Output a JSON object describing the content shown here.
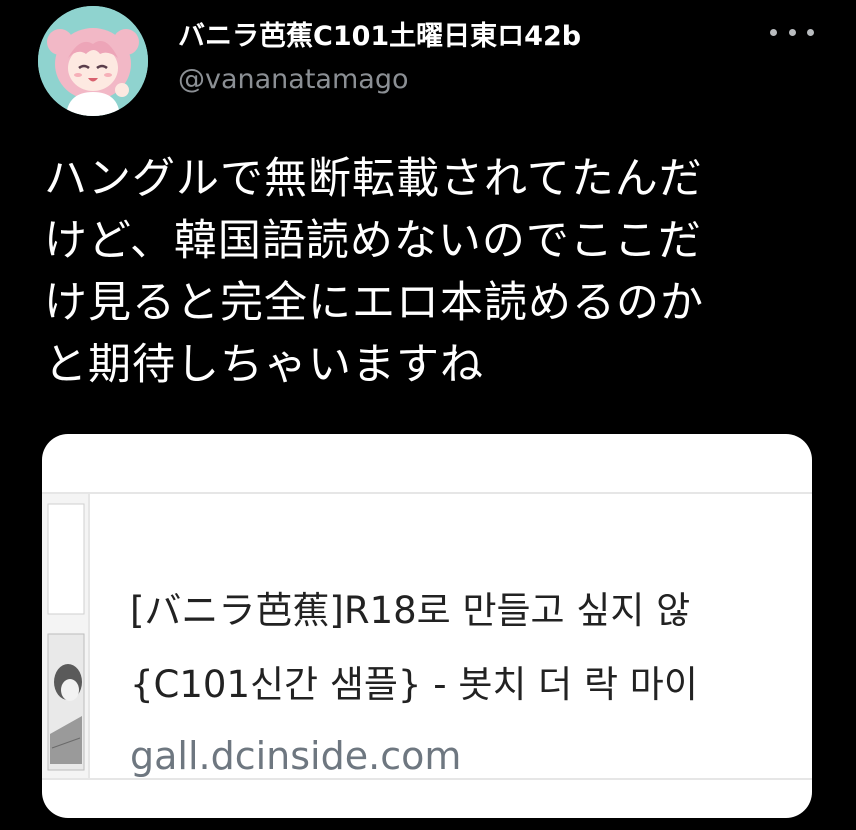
{
  "user": {
    "display_name": "バニラ芭蕉C101土曜日東ロ42b",
    "handle": "@vananatamago",
    "avatar_icon": "anime-girl-avatar-icon"
  },
  "menu": {
    "icon": "more-options-icon"
  },
  "tweet": {
    "lines": [
      "ハングルで無断転載されてたんだ",
      "けど、韓国語読めないのでここだ",
      "け見ると完全にエロ本読めるのか",
      "と期待しちゃいますね"
    ]
  },
  "link_card": {
    "title_line1": "[バニラ芭蕉]R18로 만들고 싶지 않",
    "title_line2": "{C101신간 샘플} - 봇치 더 락 마이",
    "domain": "gall.dcinside.com",
    "thumbnail_icon": "manga-thumbnail-icon"
  },
  "colors": {
    "background": "#000000",
    "text_primary": "#ffffff",
    "text_secondary": "#8b8f94",
    "card_background": "#ffffff",
    "card_domain": "#6e7780"
  }
}
